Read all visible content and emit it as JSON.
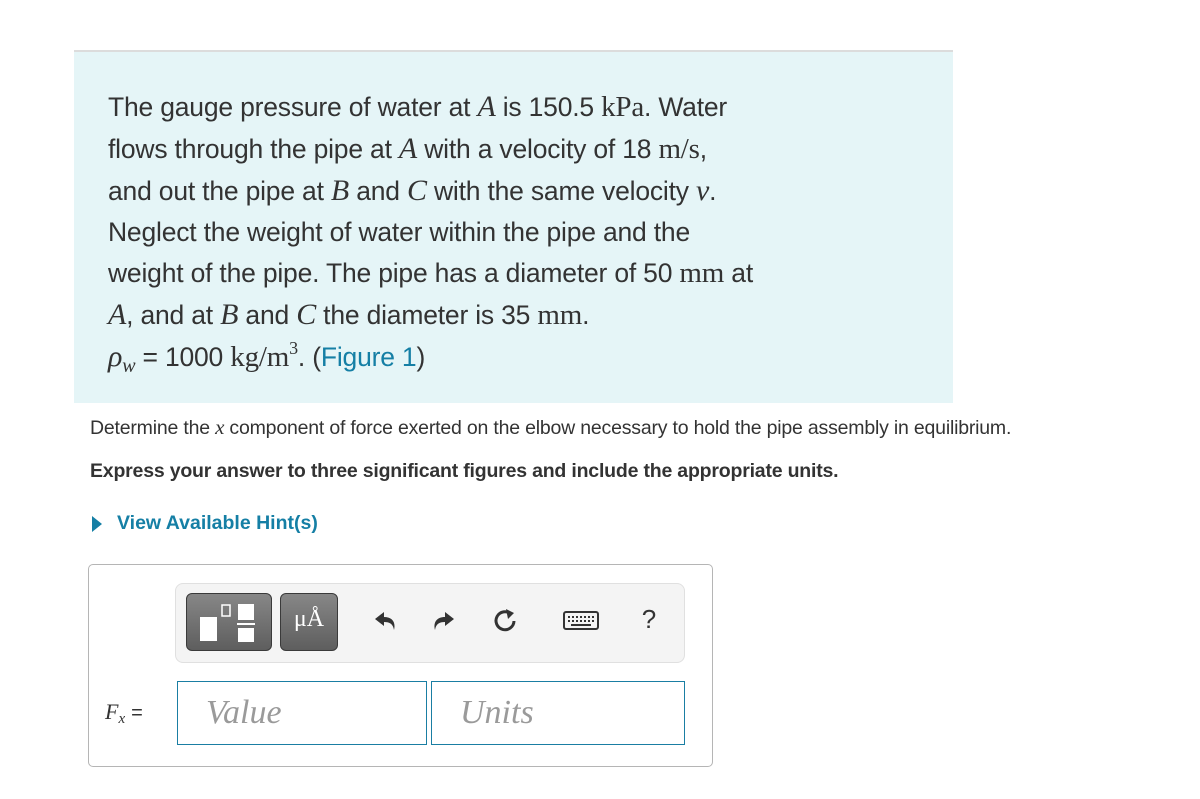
{
  "problem": {
    "line1": {
      "t1": "The gauge pressure of water at ",
      "var_a": "A",
      "t2": " is 150.5 ",
      "unit_kpa": "kPa",
      "t3": ". Water"
    },
    "line2": {
      "t1": "flows through the pipe at ",
      "var_a": "A",
      "t2": " with a velocity of 18 ",
      "unit_ms": "m/s",
      "t3": ","
    },
    "line3": {
      "t1": "and out the pipe at ",
      "var_b": "B",
      "t2": " and ",
      "var_c": "C",
      "t3": " with the same velocity ",
      "var_v": "v",
      "t4": "."
    },
    "line4": {
      "t1": "Neglect the weight of water within the pipe and the"
    },
    "line5": {
      "t1": "weight of the pipe. The pipe has a diameter of 50 ",
      "unit_mm": "mm",
      "t2": " at"
    },
    "line6": {
      "var_a": "A",
      "t1": ", and at ",
      "var_b": "B",
      "t2": " and ",
      "var_c": "C",
      "t3": " the diameter is 35 ",
      "unit_mm": "mm",
      "t4": "."
    },
    "line7": {
      "rho": "ρ",
      "rho_sub": "w",
      "t1": " = 1000 ",
      "unit_kg": "kg/m",
      "unit_exp": "3",
      "t2": ". (",
      "figure_link": "Figure 1",
      "t3": ")"
    }
  },
  "question": {
    "t1": "Determine the ",
    "var_x": "x",
    "t2": " component of force exerted on the elbow necessary to hold the pipe assembly in equilibrium."
  },
  "instruction": "Express your answer to three significant figures and include the appropriate units.",
  "hint_link": "View Available Hint(s)",
  "toolbar": {
    "templates_icon": "templates-icon",
    "units_label": "μÅ",
    "undo_icon": "undo-icon",
    "redo_icon": "redo-icon",
    "reset_icon": "reset-icon",
    "keyboard_icon": "keyboard-icon",
    "help_label": "?"
  },
  "answer": {
    "label_var": "F",
    "label_sub": "x",
    "label_eq": "=",
    "value_placeholder": "Value",
    "units_placeholder": "Units",
    "value": "",
    "units": ""
  },
  "colors": {
    "info_bg": "#e5f5f7",
    "link": "#157fa5",
    "input_border": "#1a7ea3",
    "toolbar_button": "#6e6e6e"
  }
}
